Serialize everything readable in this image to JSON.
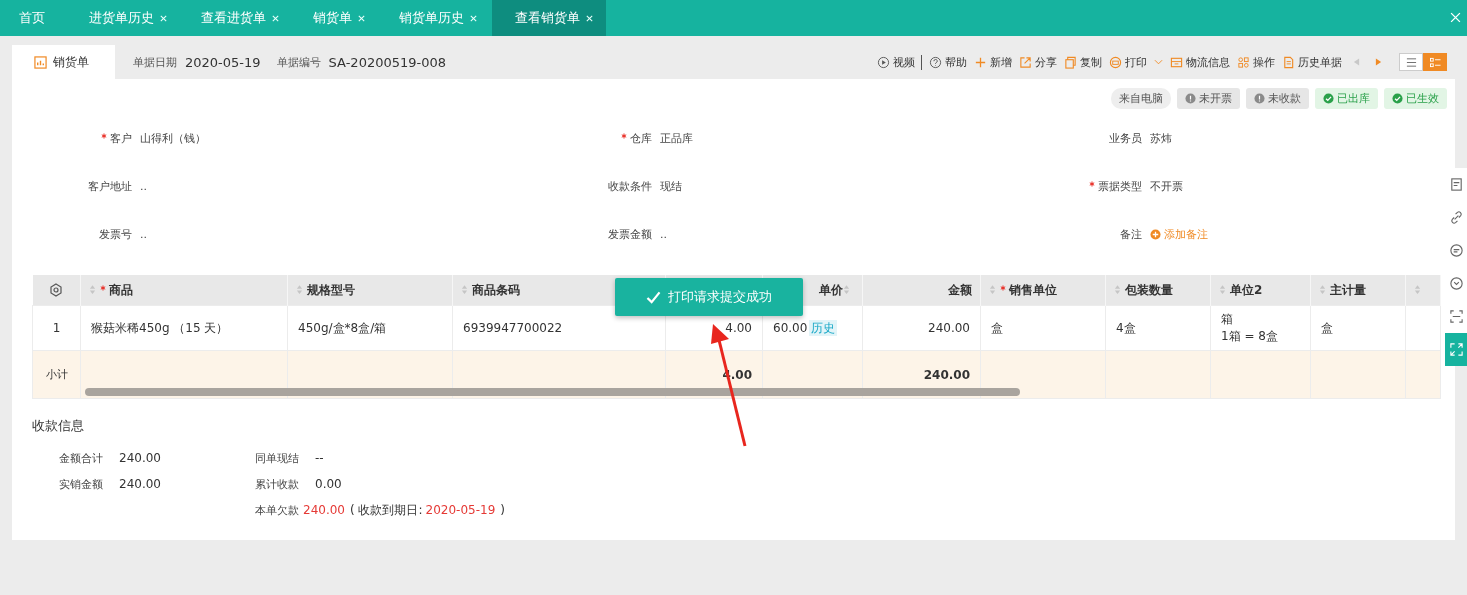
{
  "tabs": [
    {
      "label": "首页",
      "closable": false,
      "selected": false
    },
    {
      "label": "进货单历史",
      "closable": true,
      "selected": false
    },
    {
      "label": "查看进货单",
      "closable": true,
      "selected": false
    },
    {
      "label": "销货单",
      "closable": true,
      "selected": false
    },
    {
      "label": "销货单历史",
      "closable": true,
      "selected": false
    },
    {
      "label": "查看销货单",
      "closable": true,
      "selected": true
    }
  ],
  "doc_header": {
    "doc_tab": "销货单",
    "date_label": "单据日期",
    "date": "2020-05-19",
    "number_label": "单据编号",
    "number": "SA-20200519-008"
  },
  "toolbar": [
    {
      "kind": "video",
      "label": "视频",
      "divider_after": true
    },
    {
      "kind": "help",
      "label": "帮助",
      "divider_after": false
    },
    {
      "kind": "add",
      "label": "新增",
      "divider_after": false
    },
    {
      "kind": "share",
      "label": "分享",
      "divider_after": false
    },
    {
      "kind": "copy",
      "label": "复制",
      "divider_after": false
    },
    {
      "kind": "print",
      "label": "打印",
      "dropdown": true,
      "divider_after": false
    },
    {
      "kind": "logistics",
      "label": "物流信息",
      "divider_after": false
    },
    {
      "kind": "operate",
      "label": "操作",
      "divider_after": false
    },
    {
      "kind": "history",
      "label": "历史单据",
      "divider_after": false
    }
  ],
  "nav": [
    {
      "enabled": false
    },
    {
      "enabled": true
    }
  ],
  "view_toggle": [
    {
      "selected": false
    },
    {
      "selected": true
    }
  ],
  "status_tags": [
    {
      "kind": "source",
      "label": "来自电脑"
    },
    {
      "kind": "pending",
      "label": "未开票"
    },
    {
      "kind": "pending",
      "label": "未收款"
    },
    {
      "kind": "done",
      "label": "已出库"
    },
    {
      "kind": "done",
      "label": "已生效"
    }
  ],
  "form": [
    {
      "label": "客户",
      "value": "山得利（钱）",
      "required": true
    },
    {
      "label": "仓库",
      "value": "正品库",
      "required": true
    },
    {
      "label": "业务员",
      "value": "苏炜",
      "required": false
    },
    {
      "label": "客户地址",
      "value": "..",
      "required": false
    },
    {
      "label": "收款条件",
      "value": "现结",
      "required": false
    },
    {
      "label": "票据类型",
      "value": "不开票",
      "required": true
    },
    {
      "label": "发票号",
      "value": "..",
      "required": false
    },
    {
      "label": "发票金额",
      "value": "..",
      "required": false
    },
    {
      "label": "备注",
      "link": "添加备注",
      "required": false
    }
  ],
  "table": {
    "columns": [
      {
        "kind": "settings"
      },
      {
        "kind": "text",
        "label": "商品",
        "required": true,
        "sortable": true
      },
      {
        "kind": "text",
        "label": "规格型号",
        "required": false,
        "sortable": true
      },
      {
        "kind": "text",
        "label": "商品条码",
        "required": false,
        "sortable": true
      },
      {
        "kind": "qty"
      },
      {
        "kind": "price",
        "label": "单价",
        "required": false,
        "sortable": true
      },
      {
        "kind": "amount",
        "label": "金额",
        "required": false,
        "sortable": false
      },
      {
        "kind": "text",
        "label": "销售单位",
        "required": true,
        "sortable": true
      },
      {
        "kind": "text",
        "label": "包装数量",
        "required": false,
        "sortable": true
      },
      {
        "kind": "text",
        "label": "单位2",
        "required": false,
        "sortable": true
      },
      {
        "kind": "text",
        "label": "主计量",
        "required": false,
        "sortable": true
      },
      {
        "kind": "text",
        "sortable": true
      }
    ],
    "rows": [
      {
        "cells": [
          {
            "text": "1"
          },
          {
            "text": "猴菇米稀450g （15 天）"
          },
          {
            "text": "450g/盒*8盒/箱"
          },
          {
            "text": "6939947700022"
          },
          {
            "text": "4.00"
          },
          {
            "text": "60.00",
            "tag": "历史"
          },
          {
            "text": "240.00"
          },
          {
            "text": "盒"
          },
          {
            "text": "4盒"
          },
          {
            "text": "箱\n1箱 = 8盒"
          },
          {
            "text": "盒"
          }
        ]
      }
    ],
    "subtotal": {
      "label": "小计",
      "quantity": "4.00",
      "amount": "240.00"
    }
  },
  "toast": "打印请求提交成功",
  "payment": {
    "title": "收款信息",
    "left": [
      {
        "label": "金额合计",
        "value": "240.00"
      },
      {
        "label": "实销金额",
        "value": "240.00"
      }
    ],
    "right": [
      {
        "label": "同单现结",
        "value": "--"
      },
      {
        "label": "累计收款",
        "value": "0.00"
      }
    ],
    "debt": {
      "label": "本单欠款",
      "value": "240.00",
      "due_prefix": "( 收款到期日:",
      "due_date": "2020-05-19",
      "due_suffix": ")"
    }
  },
  "side_tools": [
    {
      "kind": "doc",
      "selected": false
    },
    {
      "kind": "link",
      "selected": false
    },
    {
      "kind": "chat",
      "selected": false
    },
    {
      "kind": "badge",
      "selected": false
    },
    {
      "kind": "scan",
      "selected": false
    },
    {
      "kind": "expand",
      "selected": true
    }
  ]
}
